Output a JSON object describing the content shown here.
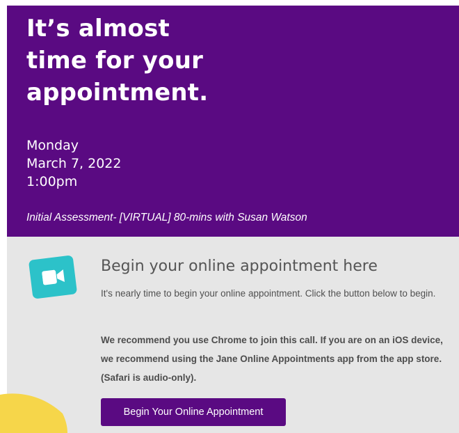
{
  "banner": {
    "headline_lines": [
      "It’s almost",
      "time for your",
      "appointment."
    ],
    "day": "Monday",
    "date": "March 7, 2022",
    "time": "1:00pm",
    "service": "Initial Assessment- [VIRTUAL] 80-mins with Susan Watson"
  },
  "card": {
    "icon": "video-camera-icon",
    "title": "Begin your online appointment here",
    "intro": "It's nearly time to begin your online appointment. Click the button below to begin.",
    "note": "We recommend you use Chrome to join this call. If you are on an iOS device, we recommend using the Jane Online Appointments app from the app store. (Safari is audio-only).",
    "button_label": "Begin Your Online Appointment"
  },
  "colors": {
    "brand_purple": "#5a0a82",
    "icon_teal": "#2cc2c9",
    "card_gray": "#e6e6e6",
    "accent_yellow": "#f6d64a"
  }
}
